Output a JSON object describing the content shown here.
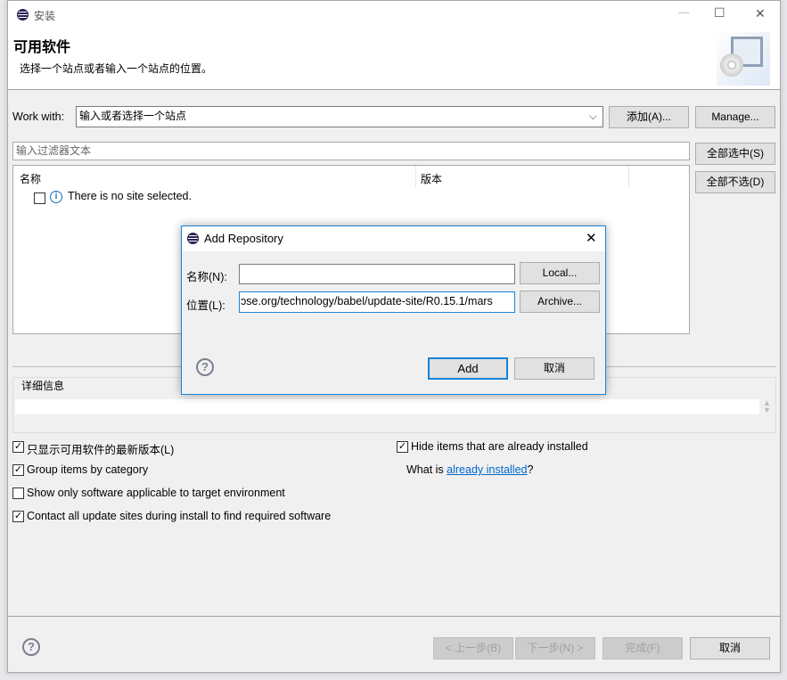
{
  "window": {
    "title": "安装",
    "minimize": "—",
    "maximize": "☐",
    "close": "✕"
  },
  "header": {
    "title": "可用软件",
    "subtitle": "选择一个站点或者输入一个站点的位置。"
  },
  "work_with": {
    "label": "Work with:",
    "value": "输入或者选择一个站点",
    "add_button": "添加(A)...",
    "manage_button": "Manage..."
  },
  "filter": {
    "placeholder": "输入过滤器文本"
  },
  "select_all": "全部选中(S)",
  "deselect_all": "全部不选(D)",
  "table": {
    "columns": [
      "名称",
      "版本"
    ],
    "rows": [
      {
        "checked": false,
        "icon": "info-icon",
        "text": "There is no site selected."
      }
    ]
  },
  "details": {
    "label": "详细信息"
  },
  "options": {
    "show_latest": {
      "label": "只显示可用软件的最新版本(L)",
      "checked": true
    },
    "group_by_category": {
      "label": "Group items by category",
      "checked": true
    },
    "show_applicable": {
      "label": "Show only software applicable to target environment",
      "checked": false
    },
    "contact_all": {
      "label": "Contact all update sites during install to find required software",
      "checked": true
    },
    "hide_installed": {
      "label": "Hide items that are already installed",
      "checked": true
    },
    "what_is": "What is ",
    "already_installed_link": "already installed",
    "question_mark": "?"
  },
  "footer": {
    "back": "< 上一步(B)",
    "next": "下一步(N) >",
    "finish": "完成(F)",
    "cancel": "取消"
  },
  "dialog": {
    "title": "Add Repository",
    "name_label": "名称(N):",
    "name_value": "",
    "location_label": "位置(L):",
    "location_value": "ɔse.org/technology/babel/update-site/R0.15.1/mars",
    "local_button": "Local...",
    "archive_button": "Archive...",
    "add_button": "Add",
    "cancel_button": "取消",
    "accent": "#1883d7"
  }
}
